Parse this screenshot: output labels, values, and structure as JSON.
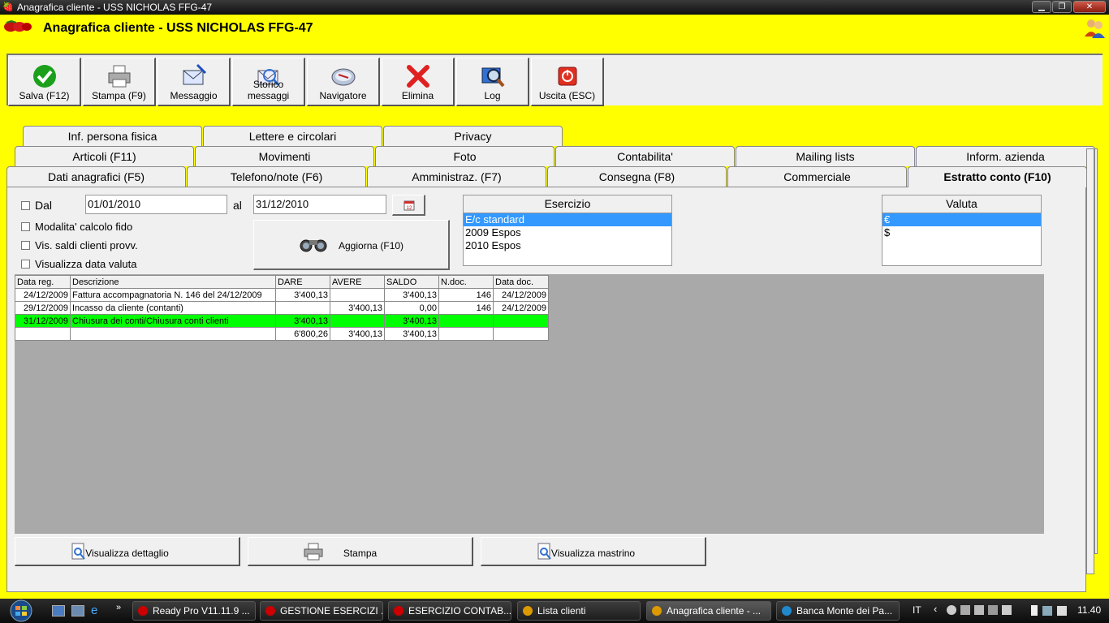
{
  "window": {
    "title": "Anagrafica cliente - USS NICHOLAS FFG-47"
  },
  "header": {
    "title": "Anagrafica cliente - USS NICHOLAS FFG-47"
  },
  "toolbar": {
    "buttons": [
      {
        "label": "Salva (F12)",
        "icon": "check-icon"
      },
      {
        "label": "Stampa (F9)",
        "icon": "printer-icon"
      },
      {
        "label": "Messaggio",
        "icon": "message-icon"
      },
      {
        "label": "Storico messaggi",
        "icon": "message-history-icon"
      },
      {
        "label": "Navigatore",
        "icon": "navigator-icon"
      },
      {
        "label": "Elimina",
        "icon": "delete-icon"
      },
      {
        "label": "Log",
        "icon": "log-icon"
      },
      {
        "label": "Uscita (ESC)",
        "icon": "exit-icon"
      }
    ]
  },
  "tabs": {
    "row1": [
      "Inf. persona fisica",
      "Lettere e circolari",
      "Privacy"
    ],
    "row2": [
      "Articoli (F11)",
      "Movimenti",
      "Foto",
      "Contabilita'",
      "Mailing lists",
      "Inform. azienda"
    ],
    "row3": [
      "Dati anagrafici (F5)",
      "Telefono/note (F6)",
      "Amministraz. (F7)",
      "Consegna (F8)",
      "Commerciale",
      "Estratto conto (F10)"
    ]
  },
  "filters": {
    "dal_label": "Dal",
    "dal_value": "01/01/2010",
    "al_label": "al",
    "al_value": "31/12/2010",
    "modalita": "Modalita' calcolo fido",
    "vis_saldi": "Vis. saldi clienti provv.",
    "vis_data": "Visualizza data valuta",
    "aggiorna": "Aggiorna (F10)"
  },
  "esercizio": {
    "header": "Esercizio",
    "items": [
      "E/c standard",
      "2009 Espos",
      "2010 Espos"
    ],
    "selected": 0
  },
  "valuta": {
    "header": "Valuta",
    "items": [
      "€",
      "$"
    ],
    "selected": 0
  },
  "table": {
    "columns": [
      "Data reg.",
      "Descrizione",
      "DARE",
      "AVERE",
      "SALDO",
      "N.doc.",
      "Data doc."
    ],
    "rows": [
      [
        "24/12/2009",
        "Fattura accompagnatoria N. 146 del 24/12/2009",
        "3'400,13",
        "",
        "3'400,13",
        "146",
        "24/12/2009"
      ],
      [
        "29/12/2009",
        "Incasso da cliente (contanti)",
        "",
        "3'400,13",
        "0,00",
        "146",
        "24/12/2009"
      ],
      [
        "31/12/2009",
        "Chiusura dei conti/Chiusura conti clienti",
        "3'400,13",
        "",
        "3'400,13",
        "",
        ""
      ],
      [
        "",
        "",
        "6'800,26",
        "3'400,13",
        "3'400,13",
        "",
        ""
      ]
    ]
  },
  "bottom": {
    "dettaglio": "Visualizza dettaglio",
    "stampa": "Stampa",
    "mastrino": "Visualizza mastrino"
  },
  "taskbar": {
    "tasks": [
      "Ready Pro V11.11.9 ...",
      "GESTIONE ESERCIZI ...",
      "ESERCIZIO CONTAB...",
      "Lista clienti",
      "Anagrafica cliente - ...",
      "Banca Monte dei Pa..."
    ],
    "lang": "IT",
    "clock": "11.40"
  },
  "colors": {
    "background": "#ffff00",
    "selection": "#3399ff",
    "highlight_row": "#00ff00",
    "grid_bg": "#a9a9a9"
  }
}
